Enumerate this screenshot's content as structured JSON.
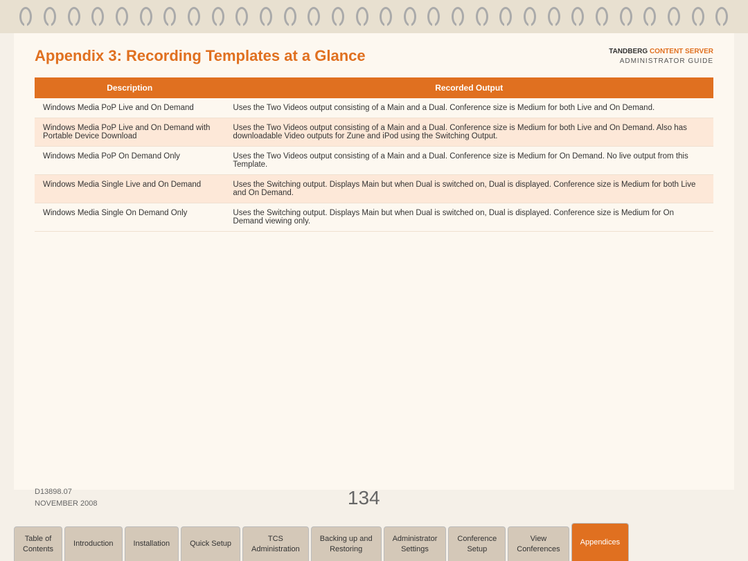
{
  "brand": {
    "tandberg": "TANDBERG",
    "content_server": "CONTENT SERVER",
    "admin_guide": "ADMINISTRATOR GUIDE"
  },
  "page": {
    "title": "Appendix 3: Recording Templates at a Glance",
    "page_number": "134",
    "doc_id": "D13898.07",
    "date": "NOVEMBER 2008"
  },
  "table": {
    "headers": [
      "Description",
      "Recorded Output"
    ],
    "rows": [
      {
        "description": "Windows Media PoP Live and On Demand",
        "output": "Uses the Two Videos output consisting of a Main and a Dual. Conference size is Medium for both Live and On Demand."
      },
      {
        "description": "Windows Media PoP Live and On Demand with Portable Device Download",
        "output": "Uses the Two Videos output consisting of a Main and a Dual. Conference size is Medium for both Live and On Demand. Also has downloadable Video outputs for Zune and iPod using the Switching Output."
      },
      {
        "description": "Windows Media PoP On Demand Only",
        "output": "Uses the Two Videos output consisting of a Main and a Dual. Conference size is Medium for On Demand. No live output from this Template."
      },
      {
        "description": "Windows Media Single Live and On Demand",
        "output": "Uses the Switching output. Displays Main but when Dual is switched on, Dual is displayed. Conference size is Medium for both Live and On Demand."
      },
      {
        "description": "Windows Media Single On Demand Only",
        "output": "Uses the Switching output. Displays Main but when Dual is switched on, Dual is displayed. Conference size is Medium for On Demand viewing only."
      }
    ]
  },
  "nav_tabs": [
    {
      "id": "table-of-contents",
      "label": "Table of\nContents",
      "active": false
    },
    {
      "id": "introduction",
      "label": "Introduction",
      "active": false
    },
    {
      "id": "installation",
      "label": "Installation",
      "active": false
    },
    {
      "id": "quick-setup",
      "label": "Quick Setup",
      "active": false
    },
    {
      "id": "tcs-administration",
      "label": "TCS\nAdministration",
      "active": false
    },
    {
      "id": "backing-up",
      "label": "Backing up and\nRestoring",
      "active": false
    },
    {
      "id": "administrator-settings",
      "label": "Administrator\nSettings",
      "active": false
    },
    {
      "id": "conference-setup",
      "label": "Conference\nSetup",
      "active": false
    },
    {
      "id": "view-conferences",
      "label": "View\nConferences",
      "active": false
    },
    {
      "id": "appendices",
      "label": "Appendices",
      "active": true
    }
  ]
}
